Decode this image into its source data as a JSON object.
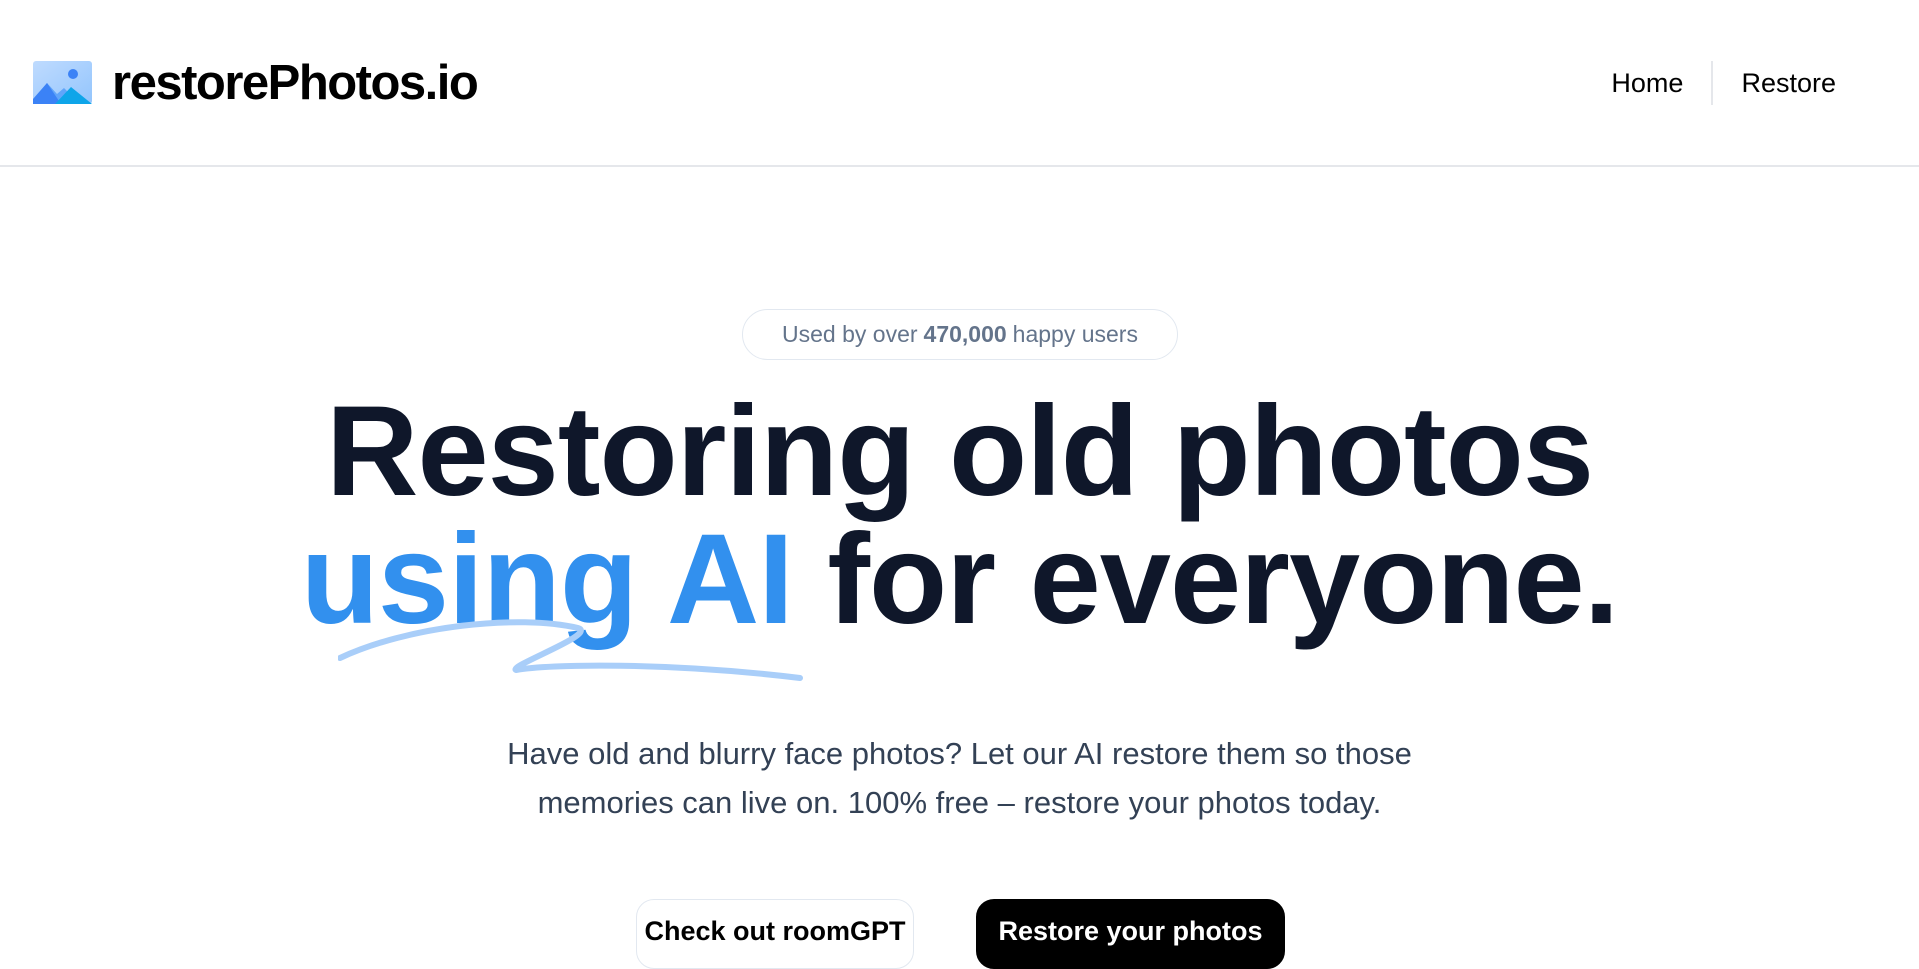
{
  "header": {
    "brand_name": "restorePhotos.io",
    "brand_icon": "photo-icon",
    "nav": {
      "home": "Home",
      "restore": "Restore"
    }
  },
  "hero": {
    "badge": {
      "prefix": "Used by over",
      "count": "470,000",
      "suffix": "happy users"
    },
    "headline": {
      "line1": "Restoring old photos",
      "accent": "using AI",
      "rest": "for everyone."
    },
    "subtitle": {
      "line1": "Have old and blurry face photos? Let our AI restore them so those",
      "line2": "memories can live on. 100% free – restore your photos today."
    },
    "buttons": {
      "secondary": "Check out roomGPT",
      "primary": "Restore your photos"
    }
  },
  "colors": {
    "accent": "#3290ee",
    "headline": "#0f172a",
    "muted": "#64748b",
    "squiggle": "#a9cef9"
  }
}
